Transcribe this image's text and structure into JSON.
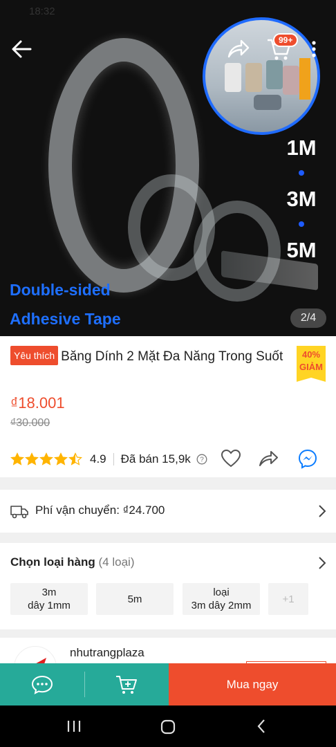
{
  "status_bar": {
    "time": "18:32"
  },
  "hero": {
    "sizes": [
      "1M",
      "3M",
      "5M"
    ],
    "caption_line1": "Double-sided",
    "caption_line2": "Adhesive Tape",
    "image_counter": "2/4",
    "cart_badge": "99+"
  },
  "product": {
    "favorite_label": "Yêu thích",
    "title": "Băng Dính 2 Mặt Đa Năng Trong Suốt",
    "discount_percent": "40%",
    "discount_label": "GIẢM",
    "price": "₫18.001",
    "original_price": "₫30.000",
    "rating": "4.9",
    "rating_value": 4.5,
    "sold": "Đã bán 15,9k"
  },
  "shipping": {
    "label": "Phí vận chuyển: ₫24.700"
  },
  "variants": {
    "heading": "Chọn loại hàng",
    "count": "(4 loại)",
    "options": [
      {
        "line1": "3m",
        "line2": "dây 1mm"
      },
      {
        "line1": "5m",
        "line2": ""
      },
      {
        "line1": "loại",
        "line2": "3m dây 2mm"
      },
      {
        "line1": "+1",
        "line2": ""
      }
    ]
  },
  "shop": {
    "name": "nhutrangplaza"
  },
  "bottom_bar": {
    "buy_label": "Mua ngay"
  },
  "colors": {
    "accent": "#ee4d2d",
    "teal": "#26aa99",
    "caption_blue": "#1e6fff",
    "star": "#ffb400"
  }
}
